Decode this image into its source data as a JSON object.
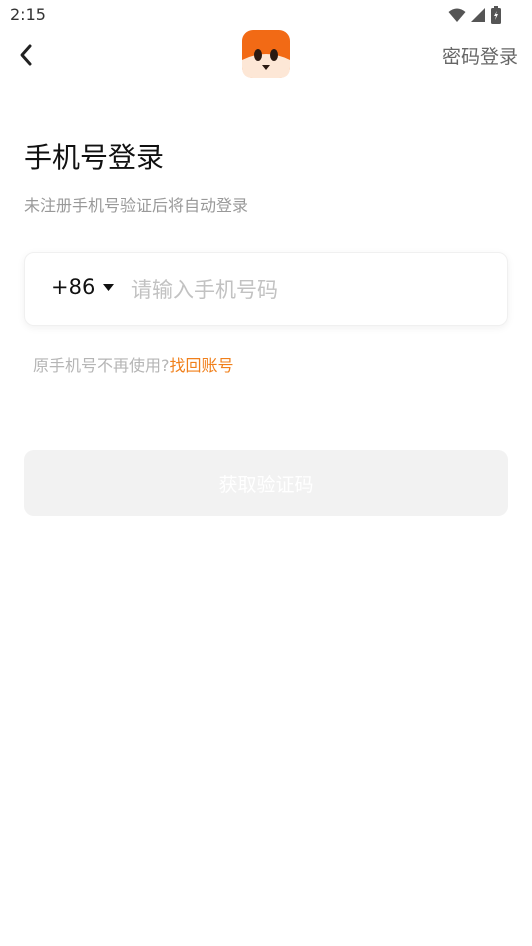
{
  "status_bar": {
    "time": "2:15",
    "icons": [
      "wifi-icon",
      "signal-icon",
      "battery-icon"
    ]
  },
  "top_bar": {
    "back_icon": "chevron-left-icon",
    "logo": "fox-app-logo",
    "password_login_label": "密码登录"
  },
  "main": {
    "title": "手机号登录",
    "subtitle": "未注册手机号验证后将自动登录",
    "phone": {
      "country_code": "+86",
      "dropdown_icon": "caret-down-icon",
      "placeholder": "请输入手机号码",
      "value": ""
    },
    "recover": {
      "hint": "原手机号不再使用?",
      "link_label": "找回账号"
    },
    "get_code_label": "获取验证码"
  },
  "colors": {
    "accent": "#f07f1a",
    "logo_orange": "#f26a15",
    "button_disabled_bg": "#f2f2f2",
    "hint_text": "#b5b5b5"
  }
}
